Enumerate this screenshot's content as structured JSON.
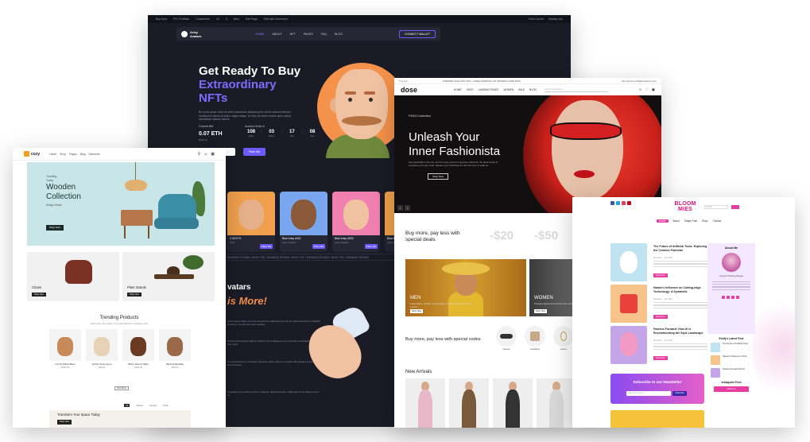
{
  "nft": {
    "topbar": {
      "items": [
        "Buy Now",
        "RTL Portfolio",
        "Customizer",
        "13",
        "3",
        "New",
        "Edit Page",
        "Edit with Elementor"
      ],
      "right": [
        "Clear Cache",
        "Howdy, info"
      ]
    },
    "logo_line1": "Arisy",
    "logo_line2": "Avatars",
    "nav": [
      "HOME",
      "ABOUT",
      "NFT",
      "PAGES",
      "FAQ",
      "BLOG"
    ],
    "connect": "CONNECT WALLET",
    "hero_line1": "Get Ready To Buy",
    "hero_line2": "Extraordinary",
    "hero_line3": "NFTs",
    "hero_desc": "Bu Lorem ipsum dolor sit amet consectetur adipiscing elit, sed do eiusmod tempor incididunt ut labore et dolore magna aliqua. Ut enim ad minim veniam quis nostrud exercitation ullamco laboris.",
    "current_bid_label": "Current Bid",
    "current_bid_value": "0.07 ETH",
    "current_bid_usd": "$334.11",
    "auction_label": "Auction Ends In",
    "timer": [
      {
        "n": "108",
        "u": "Days"
      },
      {
        "n": "03",
        "u": "Hours"
      },
      {
        "n": "17",
        "u": "Min"
      },
      {
        "n": "08",
        "u": "Sec"
      }
    ],
    "explore_button": "Explore More",
    "place_bid_button": "Place Bid",
    "cards": [
      {
        "name": "1.00 ETH",
        "price": "Arisy",
        "bid": "Place Bid"
      },
      {
        "name": "Blue Arisy #002",
        "price": "Arisy Avatars",
        "bid": "Place Bid"
      },
      {
        "name": "Blue Arisy #003",
        "price": "Arisy Avatars",
        "bid": "Place Bid"
      },
      {
        "name": "Blue Arisy #004",
        "price": "Arisy Avatars",
        "bid": "Place Bid"
      }
    ],
    "ticker": "DRAWING ROOMS • BUSH TEE • DRAWING ROOMS • BUSH TEE • DRAWING ROOMS • BUSH TEE • DRAWING ROOMS",
    "section_title": "vatars",
    "section_title2": "is More!",
    "paras": [
      "Lorem ipsum dolor sit amet consectetur adipiscing elit sed do eiusmod tempor incididunt ut labore. Ut enim ad minim veniam.",
      "Nostrud exercitation ullamco laboris nisi ut aliquip ex ea commodo consequat duis aute irure dolor.",
      "In reprehenderit in voluptate velit esse cillum dolore eu fugiat nulla pariatur excepteur sint occaecat.",
      "Cupidatat non proident sunt in culpa qui officia deserunt mollit anim id est laborum sed ut."
    ]
  },
  "cozy": {
    "logo": "cozy",
    "nav": [
      "Home",
      "Shop",
      "Pages",
      "Blog",
      "Elements"
    ],
    "hero_sub1": "Trending",
    "hero_sub2": "Today",
    "hero_title_1": "Wooden",
    "hero_title_2": "Collection",
    "hero_by": "Design Studio",
    "hero_button": "Shop Now",
    "tile1_label": "Chairs",
    "tile2_label": "Plant Stands",
    "tile_button": "Shop Now",
    "trending_title": "Trending Products",
    "trending_sub": "Duis aute irure dolor in reprehenderit in voluptate velit",
    "products": [
      {
        "name": "Comfy Pillow Bean",
        "price": "$100.00",
        "color": "#c98a5a"
      },
      {
        "name": "Amber Glow Lamp",
        "price": "$49.00",
        "color": "#e6d2b4"
      },
      {
        "name": "Bistro Round Table",
        "price": "$180.00",
        "color": "#6a3a22"
      },
      {
        "name": "Minimal Bedside",
        "price": "$99.00",
        "color": "#9a6a48"
      }
    ],
    "more_button": "View More",
    "tabs": [
      "All",
      "Chairs",
      "Lamps",
      "Sofa"
    ],
    "banner_title": "Transform Your Space Today",
    "banner_button": "Shop Now"
  },
  "dose": {
    "topbar_left": "f  t  g  p  in",
    "topbar_mid": "SUMMER SALE 25% OFF + FREE SHIPPING ON ORDERS OVER $100",
    "topbar_right": "My Account   info@doseshop.com",
    "logo": "dose",
    "nav": [
      "HOME",
      "SHOP",
      "LANDING PAGES",
      "WOMEN",
      "SALE",
      "BLOG"
    ],
    "search_placeholder": "Search products...",
    "hero_collection": "FW24 Collection",
    "hero_line1": "Unleash Your",
    "hero_line2": "Inner Fashionista",
    "hero_desc": "Are especially in the city, aim for every person's purpose. Discover the latest looks to complete your own style. Elevate your wardrobe for this Summer to walk on.",
    "hero_button": "Shop Now",
    "promo1": "Buy more, pay less with special deals",
    "prices": [
      "-$20",
      "-$50",
      "-$"
    ],
    "men_label": "MEN",
    "men_desc": "Fashionable, durable, and designed for daily wear with refined comfort.",
    "women_label": "WOMEN",
    "women_desc": "Timeless pieces and trendy looks made for every occasion.",
    "shop_button": "Shop Now",
    "promo2": "Buy more, pay less with special codes",
    "accessories": [
      "Glasses",
      "Handbags",
      "Jewelry"
    ],
    "arrivals_title": "New Arrivals",
    "models": [
      "#e8b8c8",
      "#7a5a3a",
      "#333333",
      "#d8d8d8"
    ]
  },
  "blog": {
    "logo_line1": "BLOOM",
    "logo_line2": "MIES",
    "search_placeholder": "Search",
    "nav": [
      "Home",
      "About",
      "Single Post",
      "Shop",
      "Contact"
    ],
    "posts": [
      {
        "title": "The Future of Artificial Tools: Exploring the Creative Potential",
        "meta": "By Admin · Jan 2024",
        "button": "Read More",
        "bg": "#bfe3f0",
        "obj": "#ffffff"
      },
      {
        "title": "Nature's Influence on Cutting-edge Technology: A Symbiotic",
        "meta": "By Admin · Jan 2024",
        "button": "Read More",
        "bg": "#f6c38a",
        "obj": "#e8423a"
      },
      {
        "title": "Fashion Forward: How AI is Revolutionizing the Style Landscape",
        "meta": "By Admin · Jan 2024",
        "button": "Read More",
        "bg": "#c4a5e8",
        "obj": "#f29ac4"
      }
    ],
    "newsletter_title": "Subscribe to our Newsletter",
    "newsletter_placeholder": "Enter your email",
    "newsletter_button": "Subscribe",
    "about_title": "About Me",
    "about_name": "Lifestyle & Beauty Blogger",
    "latest_title": "Emily's Latest Post",
    "latest": [
      "The Future of Artificial Tools",
      "Nature's Influence on Tech",
      "Fashion Forward with AI"
    ],
    "instagram_title": "Instagram Feed",
    "instagram_button": "Follow Us"
  }
}
